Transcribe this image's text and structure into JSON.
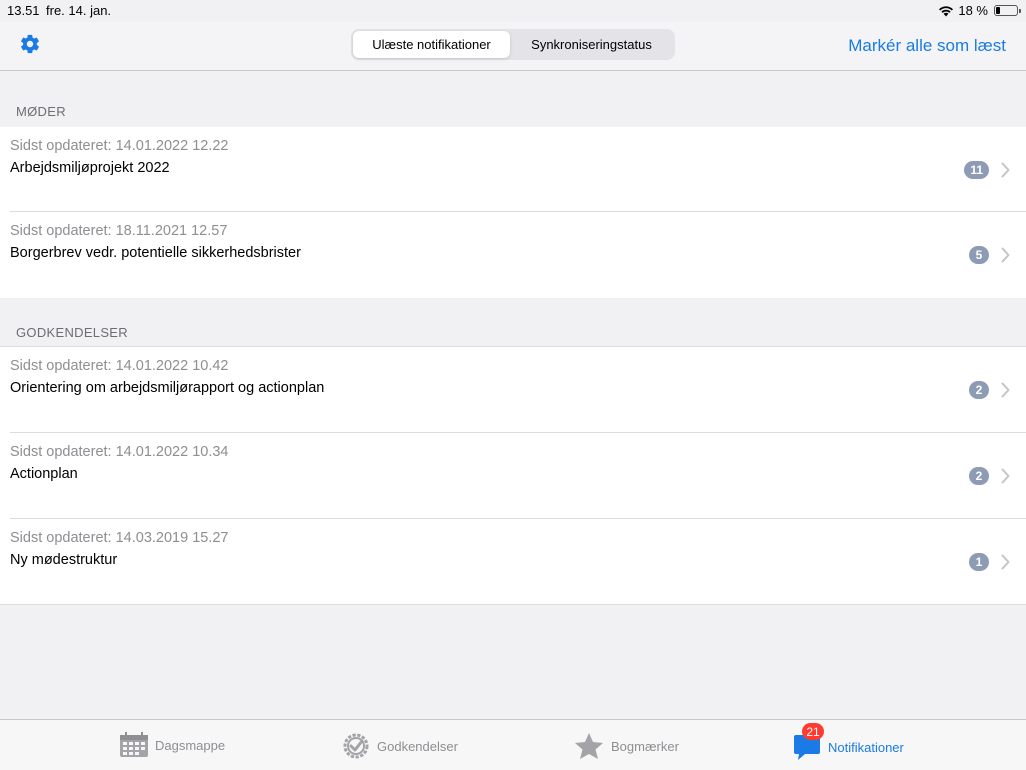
{
  "status": {
    "time": "13.51",
    "date": "fre. 14. jan.",
    "battery": "18 %",
    "battery_level": 0.18
  },
  "nav": {
    "tabs": [
      {
        "label": "Ulæste notifikationer",
        "active": true
      },
      {
        "label": "Synkroniseringstatus",
        "active": false
      }
    ],
    "mark_all_label": "Markér alle som læst"
  },
  "sections": [
    {
      "title": "MØDER",
      "items": [
        {
          "meta": "Sidst opdateret: 14.01.2022 12.22",
          "title": "Arbejdsmiljøprojekt 2022",
          "count": "11"
        },
        {
          "meta": "Sidst opdateret: 18.11.2021 12.57",
          "title": "Borgerbrev vedr. potentielle sikkerhedsbrister",
          "count": "5"
        }
      ]
    },
    {
      "title": "GODKENDELSER",
      "items": [
        {
          "meta": "Sidst opdateret: 14.01.2022 10.42",
          "title": "Orientering om arbejdsmiljørapport og actionplan",
          "count": "2"
        },
        {
          "meta": "Sidst opdateret: 14.01.2022 10.34",
          "title": "Actionplan",
          "count": "2"
        },
        {
          "meta": "Sidst opdateret: 14.03.2019 15.27",
          "title": "Ny mødestruktur",
          "count": "1"
        }
      ]
    }
  ],
  "tabbar": {
    "items": [
      {
        "label": "Dagsmappe",
        "icon": "calendar-icon"
      },
      {
        "label": "Godkendelser",
        "icon": "check-badge-icon"
      },
      {
        "label": "Bogmærker",
        "icon": "star-icon"
      },
      {
        "label": "Notifikationer",
        "icon": "chat-bubble-icon",
        "badge": "21",
        "active": true
      }
    ]
  },
  "colors": {
    "accent": "#1a7be6",
    "badge": "#8e9bb4",
    "alert": "#ff3b30"
  }
}
